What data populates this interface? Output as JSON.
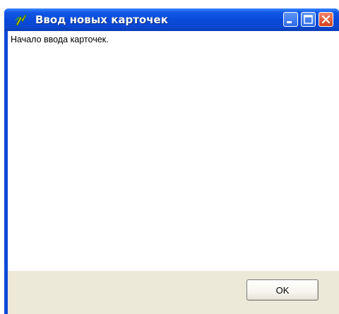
{
  "window": {
    "title": "Ввод новых карточек",
    "icon": "app-icon",
    "controls": [
      "minimize-icon",
      "maximize-icon",
      "close-icon"
    ]
  },
  "content": {
    "message": "Начало ввода карточек."
  },
  "footer": {
    "ok_label": "OK"
  },
  "colors": {
    "titlebar": "#0a49d6",
    "client": "#ece9d8",
    "content_bg": "#ffffff",
    "close_button": "#d8401c"
  }
}
